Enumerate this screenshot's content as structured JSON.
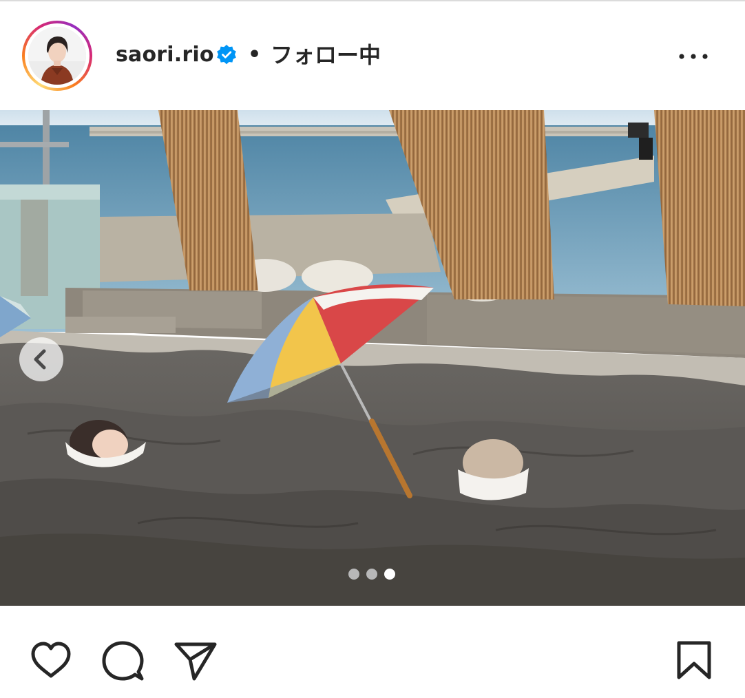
{
  "post": {
    "username": "saori.rio",
    "separator": "•",
    "follow_status": "フォロー中",
    "verified": true
  },
  "icons": {
    "verified": "verified-badge-icon",
    "more": "more-options-icon",
    "prev": "chevron-left-icon",
    "like": "heart-icon",
    "comment": "comment-icon",
    "share": "paper-plane-icon",
    "save": "bookmark-icon"
  },
  "carousel": {
    "total_slides": 3,
    "current_slide": 3
  },
  "colors": {
    "text": "#262626",
    "verified_blue": "#0095f6",
    "dot_inactive": "#b8b8b8",
    "dot_active": "#ffffff"
  }
}
